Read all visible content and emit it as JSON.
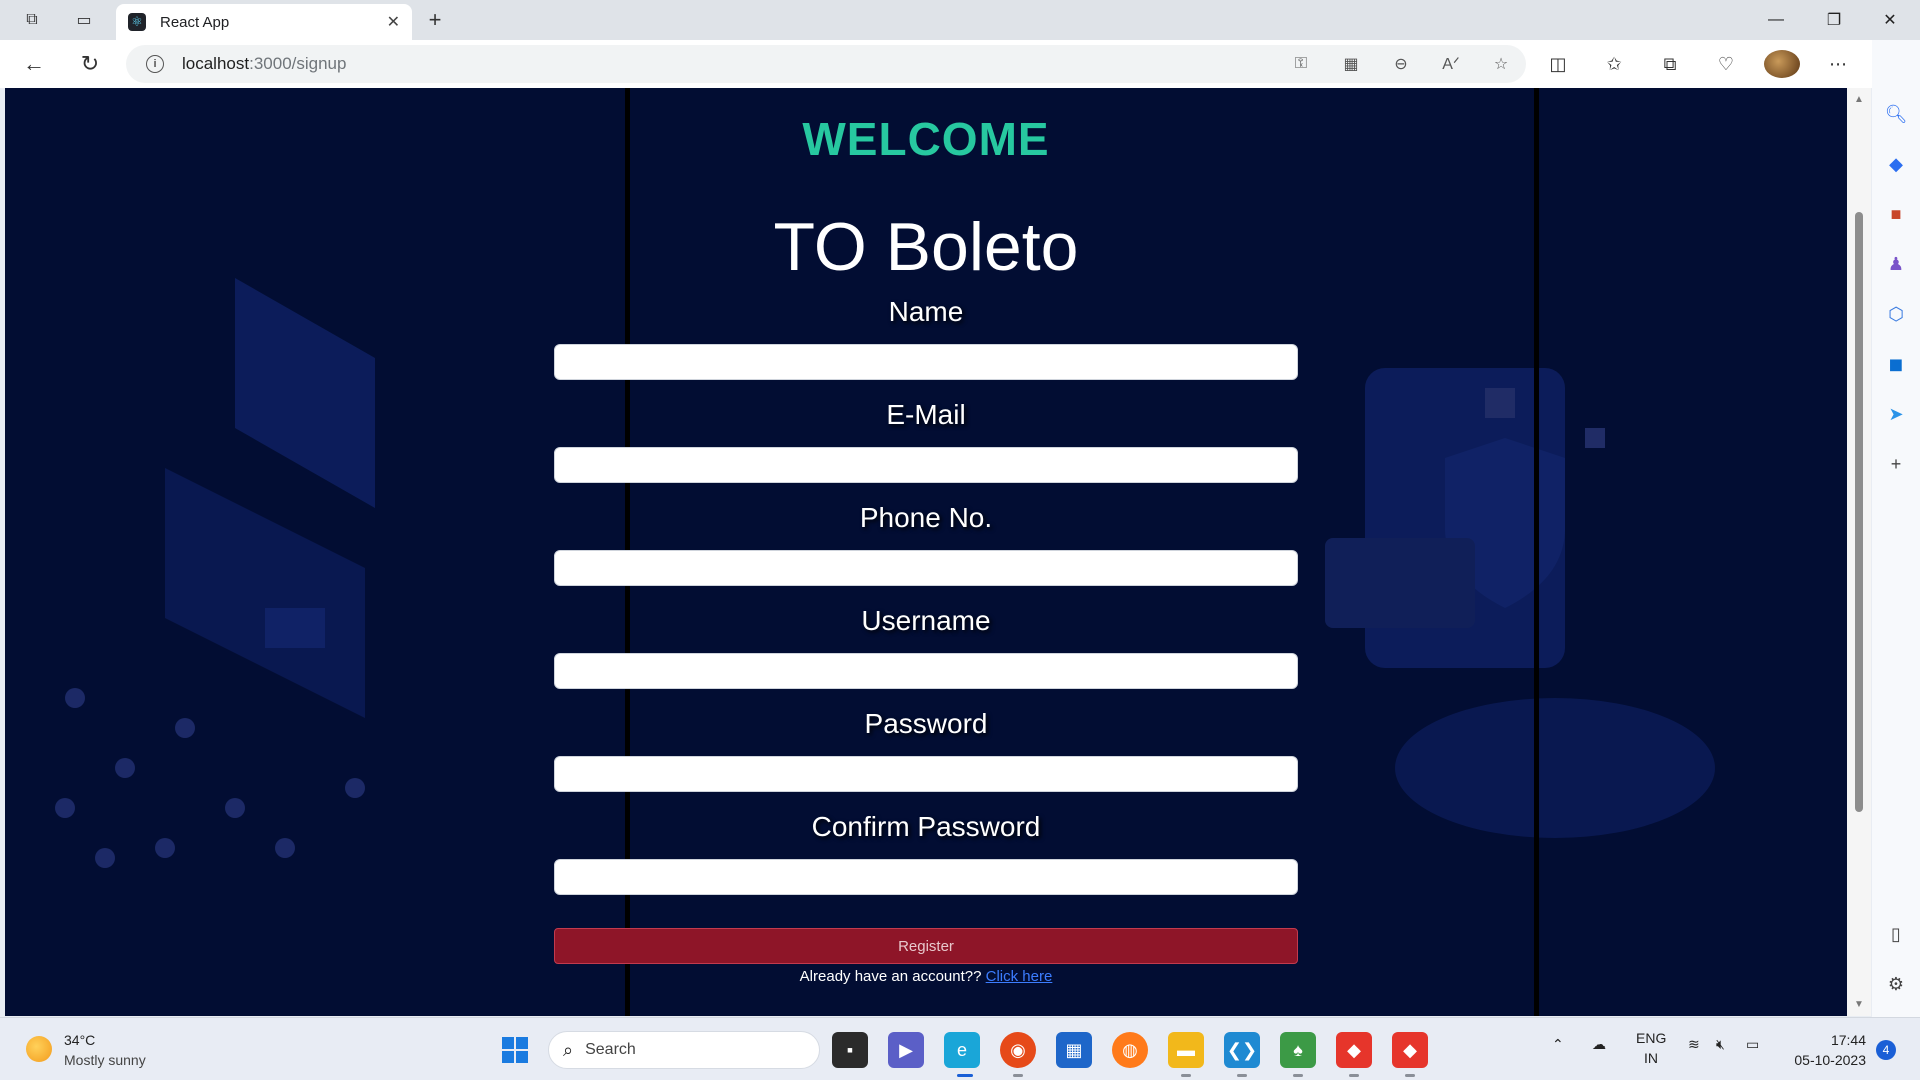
{
  "browser": {
    "tab_title": "React App",
    "url_host": "localhost",
    "url_path": ":3000/signup"
  },
  "page": {
    "welcome": "WELCOME",
    "brand": "TO Boleto",
    "fields": [
      {
        "label": "Name",
        "value": ""
      },
      {
        "label": "E-Mail",
        "value": ""
      },
      {
        "label": "Phone No.",
        "value": ""
      },
      {
        "label": "Username",
        "value": ""
      },
      {
        "label": "Password",
        "value": ""
      },
      {
        "label": "Confirm Password",
        "value": ""
      }
    ],
    "register_label": "Register",
    "already_text": "Already have an account??",
    "login_link": "Click here"
  },
  "colors": {
    "background": "#020d33",
    "welcome": "#27c8a0",
    "register": "#8e1528",
    "link": "#3c7dff"
  },
  "taskbar": {
    "temperature": "34°C",
    "weather": "Mostly sunny",
    "search_label": "Search",
    "language": "ENG",
    "region": "IN",
    "time": "17:44",
    "date": "05-10-2023",
    "notification_count": "4"
  }
}
